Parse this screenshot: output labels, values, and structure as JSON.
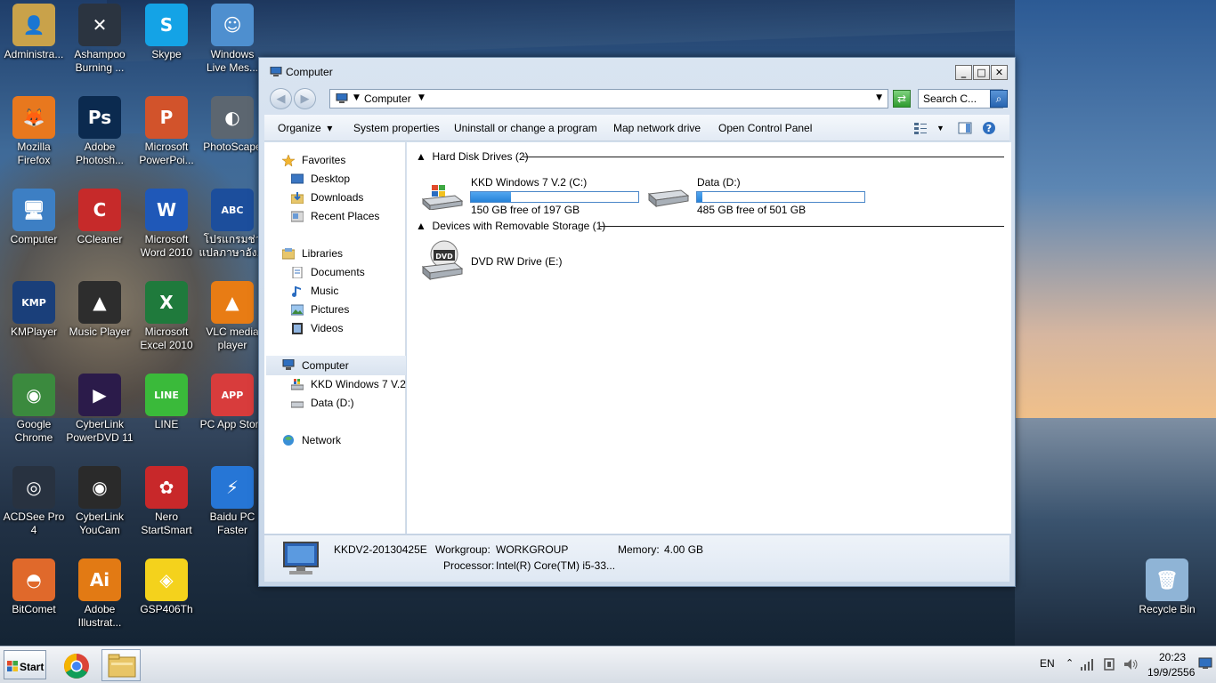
{
  "desktop": {
    "icons": [
      {
        "label": "Administra...",
        "color": "#c9a24a",
        "glyph": "👤"
      },
      {
        "label": "Ashampoo\nBurning ...",
        "color": "#2b3440",
        "glyph": "✕"
      },
      {
        "label": "Skype",
        "color": "#14a3e6",
        "glyph": "S"
      },
      {
        "label": "Windows\nLive Mes...",
        "color": "#4e8fcf",
        "glyph": "☺"
      },
      {
        "label": "Mozilla\nFirefox",
        "color": "#e8781e",
        "glyph": "🦊"
      },
      {
        "label": "Adobe\nPhotosh...",
        "color": "#0b2a4f",
        "glyph": "Ps"
      },
      {
        "label": "Microsoft\nPowerPoi...",
        "color": "#d2532b",
        "glyph": "P"
      },
      {
        "label": "PhotoScape",
        "color": "#5c6670",
        "glyph": "◐"
      },
      {
        "label": "Computer",
        "color": "#3d7fc4",
        "glyph": "🖥"
      },
      {
        "label": "CCleaner",
        "color": "#c62a2a",
        "glyph": "C"
      },
      {
        "label": "Microsoft\nWord 2010",
        "color": "#1f58b8",
        "glyph": "W"
      },
      {
        "label": "โปรแกรมช่ว\nแปลภาษาอัง...",
        "color": "#1c4e9c",
        "glyph": "ABC"
      },
      {
        "label": "KMPlayer",
        "color": "#1a3f7a",
        "glyph": "KMP"
      },
      {
        "label": "Music Player",
        "color": "#2d2d2d",
        "glyph": "▲"
      },
      {
        "label": "Microsoft\nExcel 2010",
        "color": "#1f7a3c",
        "glyph": "X"
      },
      {
        "label": "VLC media\nplayer",
        "color": "#e87c14",
        "glyph": "▲"
      },
      {
        "label": "Google\nChrome",
        "color": "#3b8a3e",
        "glyph": "◉"
      },
      {
        "label": "CyberLink\nPowerDVD 11",
        "color": "#2b1b4a",
        "glyph": "▶"
      },
      {
        "label": "LINE",
        "color": "#3aba3a",
        "glyph": "LINE"
      },
      {
        "label": "PC App Store",
        "color": "#d83c3c",
        "glyph": "APP"
      },
      {
        "label": "ACDSee Pro\n4",
        "color": "#283240",
        "glyph": "◎"
      },
      {
        "label": "CyberLink\nYouCam",
        "color": "#2a2a2a",
        "glyph": "◉"
      },
      {
        "label": "Nero\nStartSmart",
        "color": "#c8282a",
        "glyph": "✿"
      },
      {
        "label": "Baidu PC\nFaster",
        "color": "#2676d6",
        "glyph": "⚡"
      },
      {
        "label": "BitComet",
        "color": "#e0692b",
        "glyph": "◓"
      },
      {
        "label": "Adobe\nIllustrat...",
        "color": "#e27a14",
        "glyph": "Ai"
      },
      {
        "label": "GSP406Th",
        "color": "#f4d21c",
        "glyph": "◈"
      },
      {
        "label": "Recycle Bin",
        "color": "#8fb4d6",
        "glyph": "🗑"
      }
    ]
  },
  "window": {
    "title": "Computer",
    "address": "Computer",
    "search_placeholder": "Search C...",
    "toolbar": {
      "organize": "Organize",
      "system_properties": "System properties",
      "uninstall": "Uninstall or change a program",
      "map_drive": "Map network drive",
      "control_panel": "Open Control Panel"
    },
    "nav": {
      "favorites": "Favorites",
      "desktop": "Desktop",
      "downloads": "Downloads",
      "recent": "Recent Places",
      "libraries": "Libraries",
      "documents": "Documents",
      "music": "Music",
      "pictures": "Pictures",
      "videos": "Videos",
      "computer": "Computer",
      "drive_c": "KKD Windows 7 V.2",
      "drive_d": "Data (D:)",
      "network": "Network"
    },
    "groups": {
      "hdd": "Hard Disk Drives (2)",
      "removable": "Devices with Removable Storage (1)"
    },
    "drives": [
      {
        "name": "KKD Windows 7 V.2  (C:)",
        "free": "150 GB free of 197 GB",
        "used_fraction": 0.24
      },
      {
        "name": "Data (D:)",
        "free": "485 GB free of 501 GB",
        "used_fraction": 0.03
      }
    ],
    "dvd": {
      "name": "DVD RW Drive (E:)",
      "badge": "DVD"
    },
    "details": {
      "computer_name": "KKDV2-20130425E",
      "workgroup_label": "Workgroup:",
      "workgroup": "WORKGROUP",
      "memory_label": "Memory:",
      "memory": "4.00 GB",
      "processor_label": "Processor:",
      "processor": "Intel(R) Core(TM) i5-33..."
    }
  },
  "taskbar": {
    "start": "Start",
    "lang": "EN",
    "time": "20:23",
    "date": "19/9/2556"
  }
}
